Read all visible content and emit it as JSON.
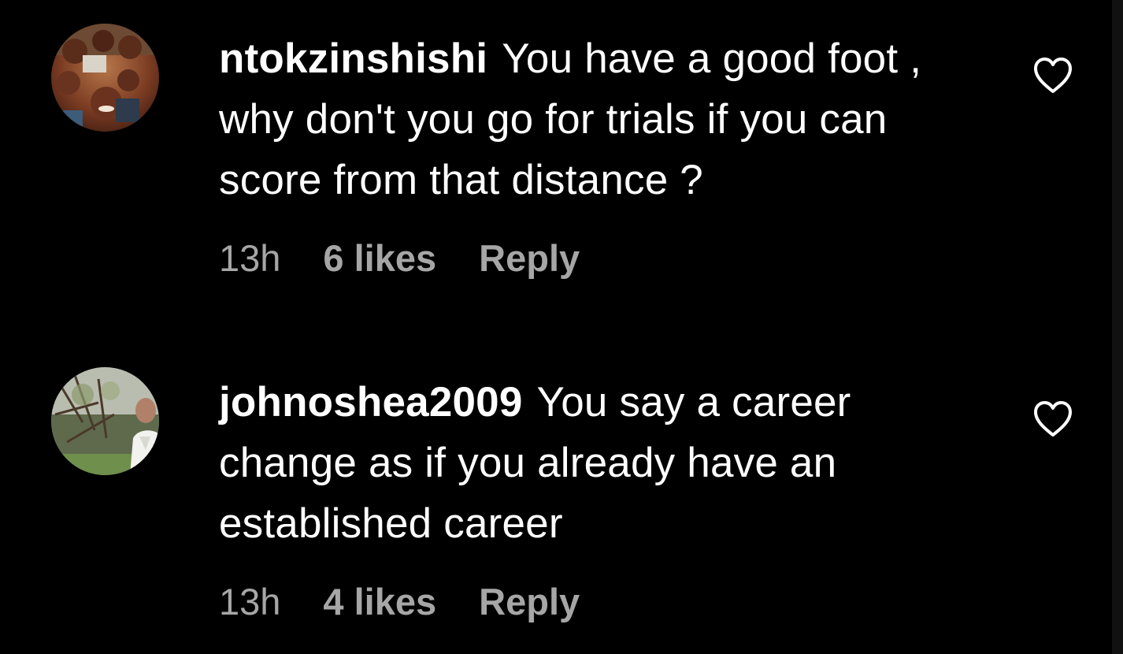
{
  "comments": [
    {
      "username": "ntokzinshishi",
      "text": "You have a good foot , why don't you go for trials if you can score from that distance ?",
      "time": "13h",
      "likes": "6 likes",
      "reply_label": "Reply",
      "avatar_icon": "group-photo-avatar",
      "like_icon": "heart-outline-icon"
    },
    {
      "username": "johnoshea2009",
      "text": "You say a career change as if you already have an established career",
      "time": "13h",
      "likes": "4 likes",
      "reply_label": "Reply",
      "avatar_icon": "outdoor-portrait-avatar",
      "like_icon": "heart-outline-icon"
    }
  ],
  "colors": {
    "background": "#000000",
    "text": "#ffffff",
    "meta_text": "#a6a6a6"
  }
}
